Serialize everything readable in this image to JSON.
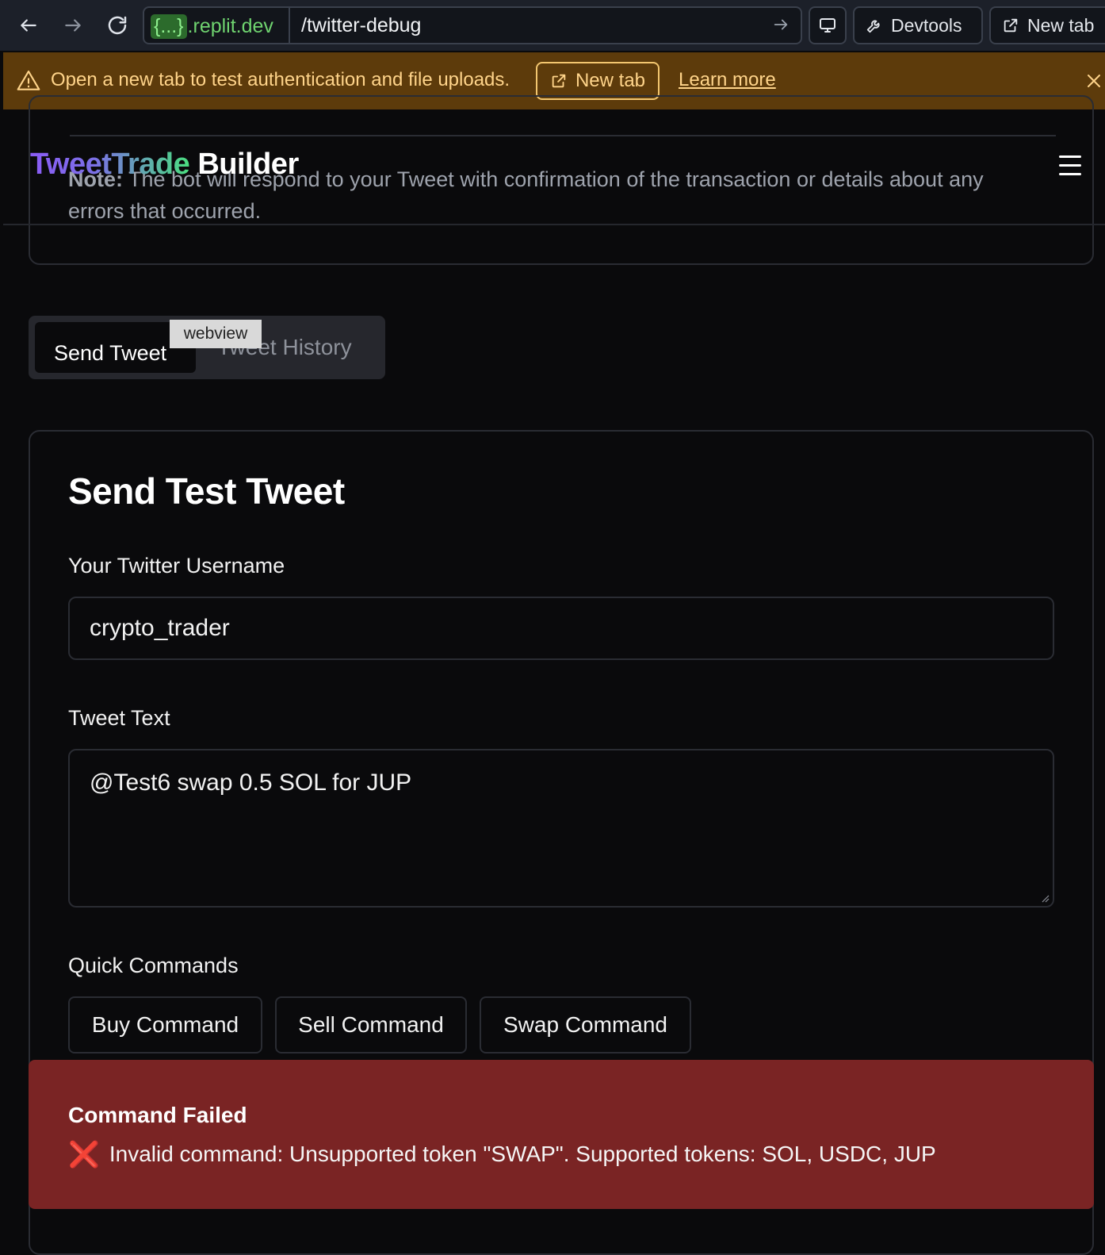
{
  "browser": {
    "url_badge": "{...}",
    "url_host": ".replit.dev",
    "url_path": "/twitter-debug",
    "devtools_label": "Devtools",
    "new_tab_label": "New tab"
  },
  "banner": {
    "message": "Open a new tab to test authentication and file uploads.",
    "new_tab_label": "New tab",
    "learn_more_label": "Learn more"
  },
  "note": {
    "bold": "Note:",
    "text": " The bot will respond to your Tweet with confirmation of the transaction or details about any errors that occurred."
  },
  "header": {
    "logo_part1": "TweetTrade",
    "logo_part2": " Builder"
  },
  "tabs": {
    "send": "Send Tweet",
    "history": "Tweet History",
    "tooltip": "webview"
  },
  "form": {
    "title": "Send Test Tweet",
    "username_label": "Your Twitter Username",
    "username_value": "crypto_trader",
    "tweet_label": "Tweet Text",
    "tweet_value": "@Test6 swap 0.5 SOL for JUP",
    "quick_label": "Quick Commands",
    "buy_label": "Buy Command",
    "sell_label": "Sell Command",
    "swap_label": "Swap Command"
  },
  "alert": {
    "title": "Command Failed",
    "icon": "❌",
    "message": "Invalid command: Unsupported token \"SWAP\". Supported tokens: SOL, USDC, JUP"
  },
  "colors": {
    "background": "#0a0a0c",
    "banner": "#5d3b0b",
    "alert": "#7a2424",
    "logo_gradient_start": "#8b5cf6",
    "logo_gradient_end": "#4ade80"
  }
}
